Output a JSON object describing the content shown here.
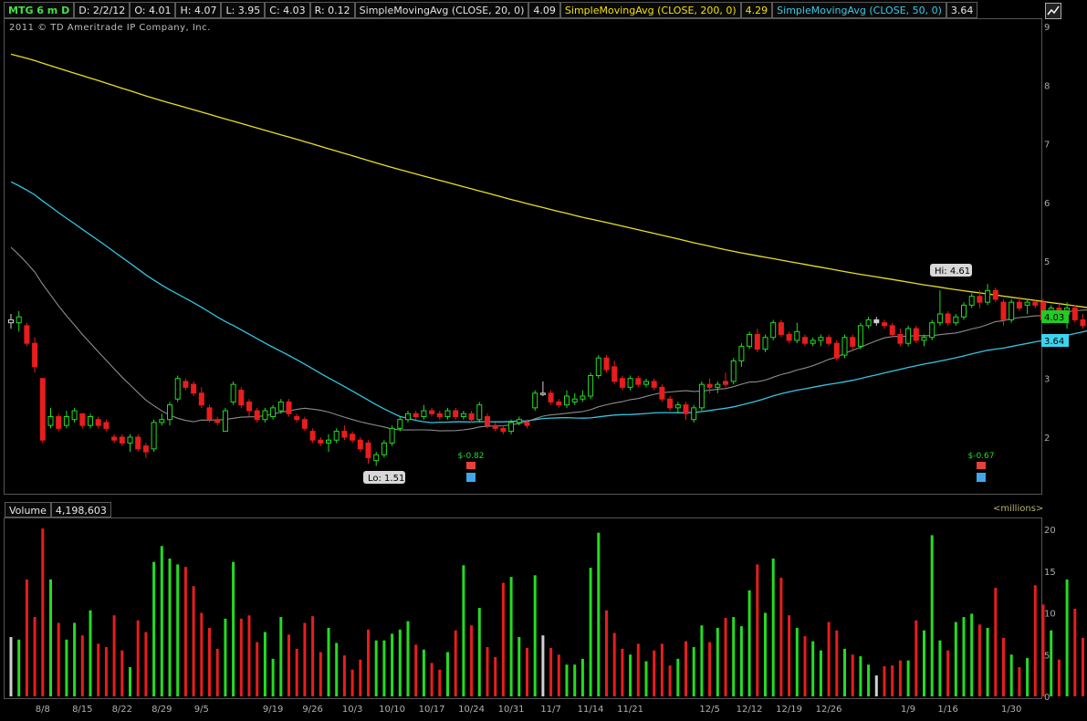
{
  "header": {
    "symbol": "MTG 6 m D",
    "date": "D: 2/2/12",
    "open": "O: 4.01",
    "high": "H: 4.07",
    "low": "L: 3.95",
    "close": "C: 4.03",
    "range": "R: 0.12",
    "sma20_label": "SimpleMovingAvg (CLOSE, 20, 0)",
    "sma20_value": "4.09",
    "sma200_label": "SimpleMovingAvg (CLOSE, 200, 0)",
    "sma200_value": "4.29",
    "sma50_label": "SimpleMovingAvg (CLOSE, 50, 0)",
    "sma50_value": "3.64"
  },
  "copyright": "2011 © TD Ameritrade IP Company, Inc.",
  "price_panel": {
    "y_ticks": [
      "9",
      "8",
      "7",
      "6",
      "5",
      "4",
      "3",
      "2"
    ],
    "hi_label": "Hi: 4.61",
    "lo_label": "Lo: 1.51",
    "last_price_badge": "4.03",
    "sma50_badge": "3.64",
    "earnings": [
      {
        "label": "$-0.82"
      },
      {
        "label": "$-0.67"
      }
    ]
  },
  "volume_panel": {
    "title": "Volume",
    "value": "4,198,603",
    "units": "<millions>",
    "y_ticks": [
      "20",
      "15",
      "10",
      "5",
      "0"
    ]
  },
  "x_labels": [
    "8/8",
    "8/15",
    "8/22",
    "8/29",
    "9/5",
    "9/19",
    "9/26",
    "10/3",
    "10/10",
    "10/17",
    "10/24",
    "10/31",
    "11/7",
    "11/14",
    "11/21",
    "12/5",
    "12/12",
    "12/19",
    "12/26",
    "1/9",
    "1/16",
    "1/30"
  ],
  "colors": {
    "up": "#22dd22",
    "down": "#e81d1d",
    "sma200": "#e8e020",
    "sma50": "#33c5e0",
    "sma20": "#8c8c8c"
  },
  "chart_data": {
    "type": "candlestick",
    "title": "MTG 6 m D",
    "ylim": [
      1.2,
      9.1
    ],
    "volume_ylim": [
      0,
      21
    ],
    "candles": [
      {
        "o": 3.95,
        "h": 4.1,
        "l": 3.85,
        "c": 4.0,
        "v": 7.1,
        "d": "neutral"
      },
      {
        "o": 3.95,
        "h": 4.15,
        "l": 3.8,
        "c": 4.05,
        "v": 6.8
      },
      {
        "o": 3.9,
        "h": 3.95,
        "l": 3.55,
        "c": 3.6,
        "v": 14.0
      },
      {
        "o": 3.6,
        "h": 3.7,
        "l": 3.1,
        "c": 3.2,
        "v": 9.5
      },
      {
        "o": 3.0,
        "h": 3.0,
        "l": 1.9,
        "c": 1.95,
        "v": 20.1
      },
      {
        "o": 2.2,
        "h": 2.5,
        "l": 2.15,
        "c": 2.35,
        "v": 14.0
      },
      {
        "o": 2.35,
        "h": 2.4,
        "l": 2.1,
        "c": 2.15,
        "v": 8.8
      },
      {
        "o": 2.2,
        "h": 2.45,
        "l": 2.15,
        "c": 2.35,
        "v": 6.8
      },
      {
        "o": 2.3,
        "h": 2.5,
        "l": 2.25,
        "c": 2.45,
        "v": 8.8
      },
      {
        "o": 2.4,
        "h": 2.4,
        "l": 2.15,
        "c": 2.2,
        "v": 7.3
      },
      {
        "o": 2.2,
        "h": 2.4,
        "l": 2.15,
        "c": 2.35,
        "v": 10.3
      },
      {
        "o": 2.3,
        "h": 2.35,
        "l": 2.15,
        "c": 2.2,
        "v": 6.3
      },
      {
        "o": 2.25,
        "h": 2.3,
        "l": 2.1,
        "c": 2.15,
        "v": 5.9
      },
      {
        "o": 2.0,
        "h": 2.05,
        "l": 1.9,
        "c": 1.95,
        "v": 9.7
      },
      {
        "o": 2.0,
        "h": 2.05,
        "l": 1.85,
        "c": 1.9,
        "v": 5.5
      },
      {
        "o": 1.9,
        "h": 2.05,
        "l": 1.75,
        "c": 2.0,
        "v": 3.5
      },
      {
        "o": 2.0,
        "h": 2.05,
        "l": 1.75,
        "c": 1.8,
        "v": 9.1
      },
      {
        "o": 1.85,
        "h": 1.9,
        "l": 1.65,
        "c": 1.75,
        "v": 7.7
      },
      {
        "o": 1.8,
        "h": 2.3,
        "l": 1.75,
        "c": 2.25,
        "v": 16.1
      },
      {
        "o": 2.25,
        "h": 2.4,
        "l": 2.2,
        "c": 2.3,
        "v": 18.0
      },
      {
        "o": 2.3,
        "h": 2.6,
        "l": 2.2,
        "c": 2.55,
        "v": 16.5
      },
      {
        "o": 2.65,
        "h": 3.05,
        "l": 2.6,
        "c": 3.0,
        "v": 15.8
      },
      {
        "o": 2.95,
        "h": 3.0,
        "l": 2.8,
        "c": 2.85,
        "v": 15.5
      },
      {
        "o": 2.9,
        "h": 2.95,
        "l": 2.7,
        "c": 2.75,
        "v": 13.2
      },
      {
        "o": 2.75,
        "h": 2.85,
        "l": 2.5,
        "c": 2.55,
        "v": 10.0
      },
      {
        "o": 2.5,
        "h": 2.55,
        "l": 2.25,
        "c": 2.3,
        "v": 8.2
      },
      {
        "o": 2.3,
        "h": 2.35,
        "l": 2.2,
        "c": 2.25,
        "v": 5.7
      },
      {
        "o": 2.1,
        "h": 2.5,
        "l": 2.1,
        "c": 2.45,
        "v": 9.3
      },
      {
        "o": 2.6,
        "h": 2.95,
        "l": 2.55,
        "c": 2.9,
        "v": 16.1
      },
      {
        "o": 2.8,
        "h": 2.85,
        "l": 2.5,
        "c": 2.55,
        "v": 9.3
      },
      {
        "o": 2.6,
        "h": 2.65,
        "l": 2.35,
        "c": 2.45,
        "v": 9.7
      },
      {
        "o": 2.45,
        "h": 2.5,
        "l": 2.25,
        "c": 2.3,
        "v": 6.5
      },
      {
        "o": 2.3,
        "h": 2.5,
        "l": 2.25,
        "c": 2.45,
        "v": 7.7
      },
      {
        "o": 2.35,
        "h": 2.55,
        "l": 2.3,
        "c": 2.5,
        "v": 4.5
      },
      {
        "o": 2.45,
        "h": 2.65,
        "l": 2.4,
        "c": 2.6,
        "v": 9.5
      },
      {
        "o": 2.6,
        "h": 2.65,
        "l": 2.35,
        "c": 2.4,
        "v": 7.4
      },
      {
        "o": 2.35,
        "h": 2.4,
        "l": 2.25,
        "c": 2.3,
        "v": 5.7
      },
      {
        "o": 2.3,
        "h": 2.35,
        "l": 2.1,
        "c": 2.15,
        "v": 8.8
      },
      {
        "o": 2.1,
        "h": 2.15,
        "l": 1.9,
        "c": 1.95,
        "v": 9.6
      },
      {
        "o": 1.95,
        "h": 2.0,
        "l": 1.85,
        "c": 1.9,
        "v": 5.3
      },
      {
        "o": 1.9,
        "h": 2.05,
        "l": 1.75,
        "c": 1.95,
        "v": 8.2
      },
      {
        "o": 1.95,
        "h": 2.15,
        "l": 1.9,
        "c": 2.1,
        "v": 6.4
      },
      {
        "o": 2.1,
        "h": 2.2,
        "l": 1.95,
        "c": 2.0,
        "v": 4.9
      },
      {
        "o": 2.05,
        "h": 2.1,
        "l": 1.9,
        "c": 1.95,
        "v": 3.2
      },
      {
        "o": 1.95,
        "h": 2.0,
        "l": 1.75,
        "c": 1.8,
        "v": 4.4
      },
      {
        "o": 1.9,
        "h": 1.95,
        "l": 1.55,
        "c": 1.65,
        "v": 8.0
      },
      {
        "o": 1.6,
        "h": 1.75,
        "l": 1.51,
        "c": 1.7,
        "v": 6.7
      },
      {
        "o": 1.7,
        "h": 1.95,
        "l": 1.65,
        "c": 1.9,
        "v": 6.7
      },
      {
        "o": 1.9,
        "h": 2.2,
        "l": 1.85,
        "c": 2.15,
        "v": 7.5
      },
      {
        "o": 2.15,
        "h": 2.35,
        "l": 2.1,
        "c": 2.3,
        "v": 8.0
      },
      {
        "o": 2.3,
        "h": 2.45,
        "l": 2.25,
        "c": 2.4,
        "v": 9.0
      },
      {
        "o": 2.4,
        "h": 2.45,
        "l": 2.3,
        "c": 2.35,
        "v": 6.2
      },
      {
        "o": 2.35,
        "h": 2.55,
        "l": 2.3,
        "c": 2.45,
        "v": 5.6
      },
      {
        "o": 2.45,
        "h": 2.5,
        "l": 2.35,
        "c": 2.4,
        "v": 4.0
      },
      {
        "o": 2.4,
        "h": 2.45,
        "l": 2.3,
        "c": 2.35,
        "v": 3.2
      },
      {
        "o": 2.35,
        "h": 2.5,
        "l": 2.3,
        "c": 2.45,
        "v": 5.3
      },
      {
        "o": 2.45,
        "h": 2.5,
        "l": 2.3,
        "c": 2.35,
        "v": 7.9
      },
      {
        "o": 2.35,
        "h": 2.45,
        "l": 2.3,
        "c": 2.4,
        "v": 15.7
      },
      {
        "o": 2.4,
        "h": 2.45,
        "l": 2.25,
        "c": 2.3,
        "v": 8.5
      },
      {
        "o": 2.3,
        "h": 2.6,
        "l": 2.25,
        "c": 2.55,
        "v": 10.6
      },
      {
        "o": 2.35,
        "h": 2.4,
        "l": 2.15,
        "c": 2.2,
        "v": 5.9
      },
      {
        "o": 2.2,
        "h": 2.25,
        "l": 2.1,
        "c": 2.15,
        "v": 4.7
      },
      {
        "o": 2.15,
        "h": 2.2,
        "l": 2.05,
        "c": 2.1,
        "v": 13.6
      },
      {
        "o": 2.1,
        "h": 2.3,
        "l": 2.05,
        "c": 2.25,
        "v": 14.3
      },
      {
        "o": 2.25,
        "h": 2.35,
        "l": 2.2,
        "c": 2.3,
        "v": 7.1
      },
      {
        "o": 2.25,
        "h": 2.3,
        "l": 2.15,
        "c": 2.2,
        "v": 5.8
      },
      {
        "o": 2.5,
        "h": 2.8,
        "l": 2.45,
        "c": 2.75,
        "v": 14.5
      },
      {
        "o": 2.75,
        "h": 2.95,
        "l": 2.7,
        "c": 2.75,
        "v": 7.3,
        "d": "neutral"
      },
      {
        "o": 2.75,
        "h": 2.8,
        "l": 2.55,
        "c": 2.6,
        "v": 5.8
      },
      {
        "o": 2.6,
        "h": 2.65,
        "l": 2.5,
        "c": 2.55,
        "v": 5.0
      },
      {
        "o": 2.55,
        "h": 2.8,
        "l": 2.5,
        "c": 2.7,
        "v": 3.8
      },
      {
        "o": 2.6,
        "h": 2.75,
        "l": 2.55,
        "c": 2.65,
        "v": 3.8
      },
      {
        "o": 2.65,
        "h": 2.8,
        "l": 2.6,
        "c": 2.7,
        "v": 4.5
      },
      {
        "o": 2.7,
        "h": 3.1,
        "l": 2.65,
        "c": 3.05,
        "v": 15.4
      },
      {
        "o": 3.05,
        "h": 3.4,
        "l": 3.0,
        "c": 3.35,
        "v": 19.6
      },
      {
        "o": 3.35,
        "h": 3.4,
        "l": 3.1,
        "c": 3.15,
        "v": 10.3
      },
      {
        "o": 3.2,
        "h": 3.3,
        "l": 2.9,
        "c": 2.95,
        "v": 7.6
      },
      {
        "o": 3.0,
        "h": 3.05,
        "l": 2.8,
        "c": 2.85,
        "v": 5.7
      },
      {
        "o": 2.85,
        "h": 3.05,
        "l": 2.8,
        "c": 3.0,
        "v": 5.0
      },
      {
        "o": 3.0,
        "h": 3.05,
        "l": 2.85,
        "c": 2.9,
        "v": 6.3
      },
      {
        "o": 2.9,
        "h": 3.0,
        "l": 2.85,
        "c": 2.95,
        "v": 4.2
      },
      {
        "o": 2.95,
        "h": 3.0,
        "l": 2.8,
        "c": 2.85,
        "v": 5.5
      },
      {
        "o": 2.85,
        "h": 2.9,
        "l": 2.6,
        "c": 2.65,
        "v": 6.3
      },
      {
        "o": 2.65,
        "h": 2.7,
        "l": 2.45,
        "c": 2.5,
        "v": 3.7
      },
      {
        "o": 2.5,
        "h": 2.6,
        "l": 2.4,
        "c": 2.55,
        "v": 4.5
      },
      {
        "o": 2.55,
        "h": 2.6,
        "l": 2.3,
        "c": 2.4,
        "v": 6.6
      },
      {
        "o": 2.3,
        "h": 2.55,
        "l": 2.25,
        "c": 2.5,
        "v": 5.9
      },
      {
        "o": 2.5,
        "h": 2.95,
        "l": 2.45,
        "c": 2.9,
        "v": 8.5
      },
      {
        "o": 2.9,
        "h": 3.0,
        "l": 2.75,
        "c": 2.85,
        "v": 6.5
      },
      {
        "o": 2.85,
        "h": 2.95,
        "l": 2.75,
        "c": 2.9,
        "v": 8.2
      },
      {
        "o": 2.95,
        "h": 3.1,
        "l": 2.85,
        "c": 2.9,
        "v": 9.4
      },
      {
        "o": 2.95,
        "h": 3.35,
        "l": 2.9,
        "c": 3.3,
        "v": 9.5
      },
      {
        "o": 3.3,
        "h": 3.6,
        "l": 3.2,
        "c": 3.55,
        "v": 8.4
      },
      {
        "o": 3.55,
        "h": 3.8,
        "l": 3.5,
        "c": 3.75,
        "v": 12.7
      },
      {
        "o": 3.75,
        "h": 3.85,
        "l": 3.45,
        "c": 3.5,
        "v": 15.8
      },
      {
        "o": 3.5,
        "h": 3.75,
        "l": 3.45,
        "c": 3.7,
        "v": 10.0
      },
      {
        "o": 3.7,
        "h": 4.0,
        "l": 3.65,
        "c": 3.95,
        "v": 16.5
      },
      {
        "o": 3.95,
        "h": 4.0,
        "l": 3.7,
        "c": 3.75,
        "v": 14.2
      },
      {
        "o": 3.75,
        "h": 3.8,
        "l": 3.6,
        "c": 3.65,
        "v": 9.7
      },
      {
        "o": 3.65,
        "h": 3.95,
        "l": 3.6,
        "c": 3.8,
        "v": 8.2
      },
      {
        "o": 3.7,
        "h": 3.75,
        "l": 3.55,
        "c": 3.6,
        "v": 7.2
      },
      {
        "o": 3.6,
        "h": 3.7,
        "l": 3.55,
        "c": 3.65,
        "v": 6.6
      },
      {
        "o": 3.65,
        "h": 3.75,
        "l": 3.55,
        "c": 3.7,
        "v": 5.5
      },
      {
        "o": 3.7,
        "h": 3.75,
        "l": 3.55,
        "c": 3.6,
        "v": 8.9
      },
      {
        "o": 3.6,
        "h": 3.65,
        "l": 3.3,
        "c": 3.35,
        "v": 7.9
      },
      {
        "o": 3.4,
        "h": 3.75,
        "l": 3.35,
        "c": 3.7,
        "v": 5.7
      },
      {
        "o": 3.7,
        "h": 3.75,
        "l": 3.5,
        "c": 3.55,
        "v": 5.0
      },
      {
        "o": 3.55,
        "h": 3.95,
        "l": 3.5,
        "c": 3.9,
        "v": 4.8
      },
      {
        "o": 3.9,
        "h": 4.05,
        "l": 3.85,
        "c": 4.0,
        "v": 3.8
      },
      {
        "o": 4.0,
        "h": 4.05,
        "l": 3.9,
        "c": 3.95,
        "v": 2.5,
        "d": "neutral"
      },
      {
        "o": 3.95,
        "h": 4.0,
        "l": 3.85,
        "c": 3.9,
        "v": 3.6
      },
      {
        "o": 3.9,
        "h": 3.95,
        "l": 3.7,
        "c": 3.75,
        "v": 3.7
      },
      {
        "o": 3.75,
        "h": 3.85,
        "l": 3.55,
        "c": 3.6,
        "v": 4.3
      },
      {
        "o": 3.6,
        "h": 3.9,
        "l": 3.55,
        "c": 3.85,
        "v": 4.3
      },
      {
        "o": 3.85,
        "h": 3.9,
        "l": 3.6,
        "c": 3.65,
        "v": 9.1
      },
      {
        "o": 3.65,
        "h": 3.75,
        "l": 3.55,
        "c": 3.7,
        "v": 7.9
      },
      {
        "o": 3.7,
        "h": 4.0,
        "l": 3.65,
        "c": 3.95,
        "v": 19.3
      },
      {
        "o": 3.95,
        "h": 4.5,
        "l": 3.9,
        "c": 4.1,
        "v": 6.7
      },
      {
        "o": 4.1,
        "h": 4.15,
        "l": 3.9,
        "c": 3.95,
        "v": 5.5
      },
      {
        "o": 3.95,
        "h": 4.1,
        "l": 3.9,
        "c": 4.05,
        "v": 8.9
      },
      {
        "o": 4.05,
        "h": 4.3,
        "l": 4.0,
        "c": 4.25,
        "v": 9.5
      },
      {
        "o": 4.25,
        "h": 4.45,
        "l": 4.2,
        "c": 4.4,
        "v": 9.9
      },
      {
        "o": 4.4,
        "h": 4.5,
        "l": 4.2,
        "c": 4.3,
        "v": 8.6
      },
      {
        "o": 4.3,
        "h": 4.61,
        "l": 4.25,
        "c": 4.5,
        "v": 8.2
      },
      {
        "o": 4.5,
        "h": 4.55,
        "l": 4.3,
        "c": 4.35,
        "v": 13.0
      },
      {
        "o": 4.3,
        "h": 4.35,
        "l": 3.9,
        "c": 4.0,
        "v": 7.0
      },
      {
        "o": 4.0,
        "h": 4.35,
        "l": 3.95,
        "c": 4.3,
        "v": 5.0
      },
      {
        "o": 4.3,
        "h": 4.4,
        "l": 4.15,
        "c": 4.2,
        "v": 3.5
      },
      {
        "o": 4.25,
        "h": 4.35,
        "l": 4.1,
        "c": 4.3,
        "v": 4.6
      },
      {
        "o": 4.3,
        "h": 4.35,
        "l": 4.2,
        "c": 4.25,
        "v": 13.3
      },
      {
        "o": 4.3,
        "h": 4.35,
        "l": 3.95,
        "c": 4.0,
        "v": 11.0
      },
      {
        "o": 4.0,
        "h": 4.25,
        "l": 3.95,
        "c": 4.2,
        "v": 7.9
      },
      {
        "o": 4.2,
        "h": 4.3,
        "l": 4.05,
        "c": 4.1,
        "v": 4.4
      },
      {
        "o": 4.1,
        "h": 4.3,
        "l": 3.85,
        "c": 4.2,
        "v": 14.0
      },
      {
        "o": 4.2,
        "h": 4.25,
        "l": 3.95,
        "c": 4.0,
        "v": 10.5
      },
      {
        "o": 4.0,
        "h": 4.1,
        "l": 3.85,
        "c": 3.9,
        "v": 7.0
      },
      {
        "o": 3.95,
        "h": 4.1,
        "l": 3.9,
        "c": 4.05,
        "v": 8.5
      },
      {
        "o": 4.01,
        "h": 4.07,
        "l": 3.95,
        "c": 4.03,
        "v": 4.2
      }
    ]
  }
}
